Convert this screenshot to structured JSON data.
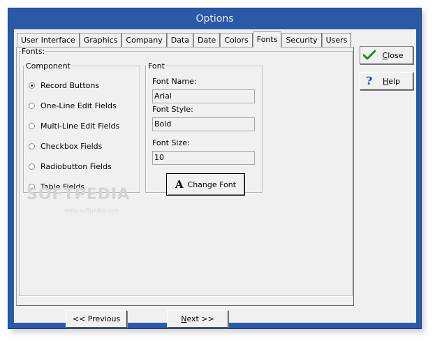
{
  "window": {
    "title": "Options"
  },
  "tabs": [
    {
      "label": "User Interface"
    },
    {
      "label": "Graphics"
    },
    {
      "label": "Company"
    },
    {
      "label": "Data"
    },
    {
      "label": "Date"
    },
    {
      "label": "Colors"
    },
    {
      "label": "Fonts",
      "active": true
    },
    {
      "label": "Security"
    },
    {
      "label": "Users"
    }
  ],
  "panel": {
    "title": "Fonts:",
    "component": {
      "title": "Component",
      "options": [
        "Record Buttons",
        "One-Line Edit Fields",
        "Multi-Line Edit Fields",
        "Checkbox Fields",
        "Radiobutton Fields",
        "Table Fields"
      ],
      "selected": "Record Buttons"
    },
    "font": {
      "title": "Font",
      "name_label": "Font Name:",
      "name_value": "Arial",
      "style_label": "Font Style:",
      "style_value": "Bold",
      "size_label": "Font Size:",
      "size_value": "10",
      "change_label": "Change Font",
      "change_icon_glyph": "A"
    }
  },
  "side": {
    "close_label": "Close",
    "help_label": "Help",
    "close_icon": "check-icon",
    "help_icon": "question-icon"
  },
  "footer": {
    "previous_label": "<< Previous",
    "next_label": "Next >>"
  },
  "watermark": {
    "text": "SOFTPEDIA",
    "sub": "www.softpedia.com"
  },
  "colors": {
    "window_frame": "#2a5aa7",
    "client": "#f0f0f0",
    "check": "#1e8a1e",
    "help": "#1a3fa8"
  }
}
